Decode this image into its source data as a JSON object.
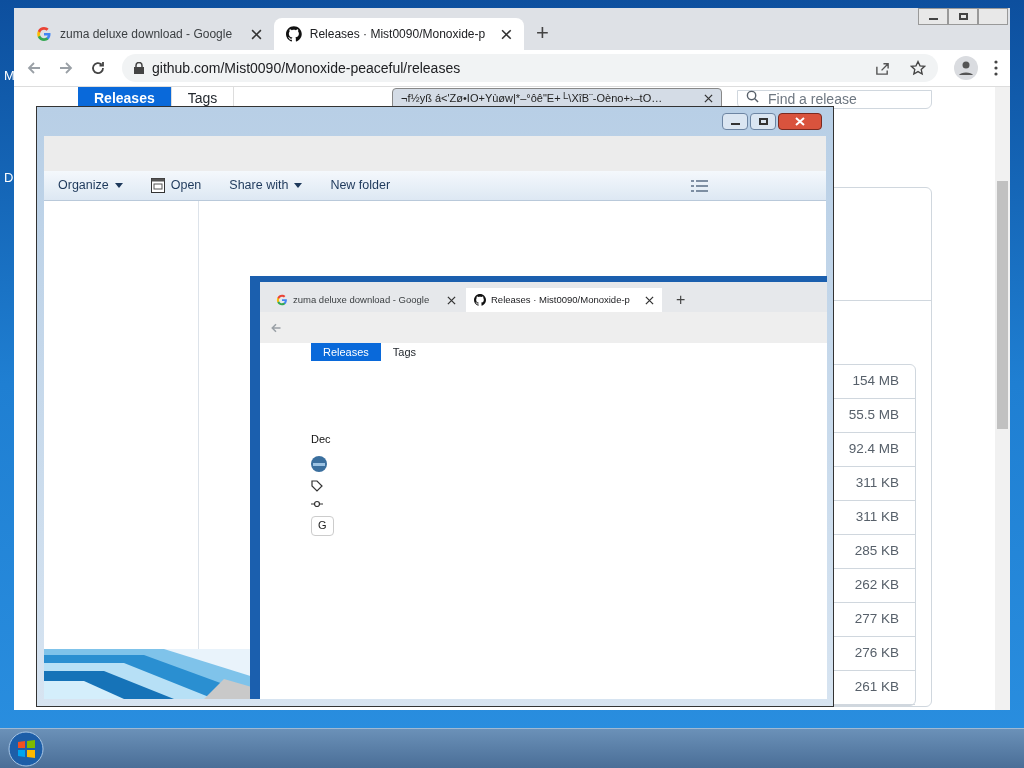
{
  "desktop": {
    "icon_labels": [
      "M",
      "D"
    ]
  },
  "browser": {
    "tabs": [
      {
        "title": "zuma deluxe download - Google",
        "selected": false
      },
      {
        "title": "Releases · Mist0090/Monoxide-p",
        "selected": true
      }
    ],
    "new_tab": "+",
    "url": "github.com/Mist0090/Monoxide-peaceful/releases",
    "page": {
      "nav_tabs": [
        {
          "label": "Releases",
          "selected": true
        },
        {
          "label": "Tags",
          "selected": false
        }
      ],
      "search": {
        "placeholder": "Find a release"
      },
      "asset_sizes": [
        "154 MB",
        "55.5 MB",
        "92.4 MB",
        "311 KB",
        "311 KB",
        "285 KB",
        "262 KB",
        "277 KB",
        "276 KB",
        "261 KB"
      ]
    }
  },
  "popup": {
    "title": "¬f½yß á<'Zø•IO+Yùøw|*–°ôê\"E+└\\XîB¨-Oèno+›–tO…"
  },
  "explorer": {
    "toolbar": [
      {
        "label": "Organize",
        "kind": "menu"
      },
      {
        "label": "Open",
        "kind": "icon"
      },
      {
        "label": "Share with",
        "kind": "menu"
      },
      {
        "label": "New folder",
        "kind": "plain"
      }
    ],
    "preview": {
      "tabs": [
        {
          "title": "zuma deluxe download - Google",
          "selected": false
        },
        {
          "title": "Releases · Mist0090/Monoxide-p",
          "selected": true
        }
      ],
      "new_tab": "+",
      "nav_tabs": [
        {
          "label": "Releases",
          "selected": true
        },
        {
          "label": "Tags",
          "selected": false
        }
      ],
      "heading": "Dec",
      "button": "G"
    }
  }
}
